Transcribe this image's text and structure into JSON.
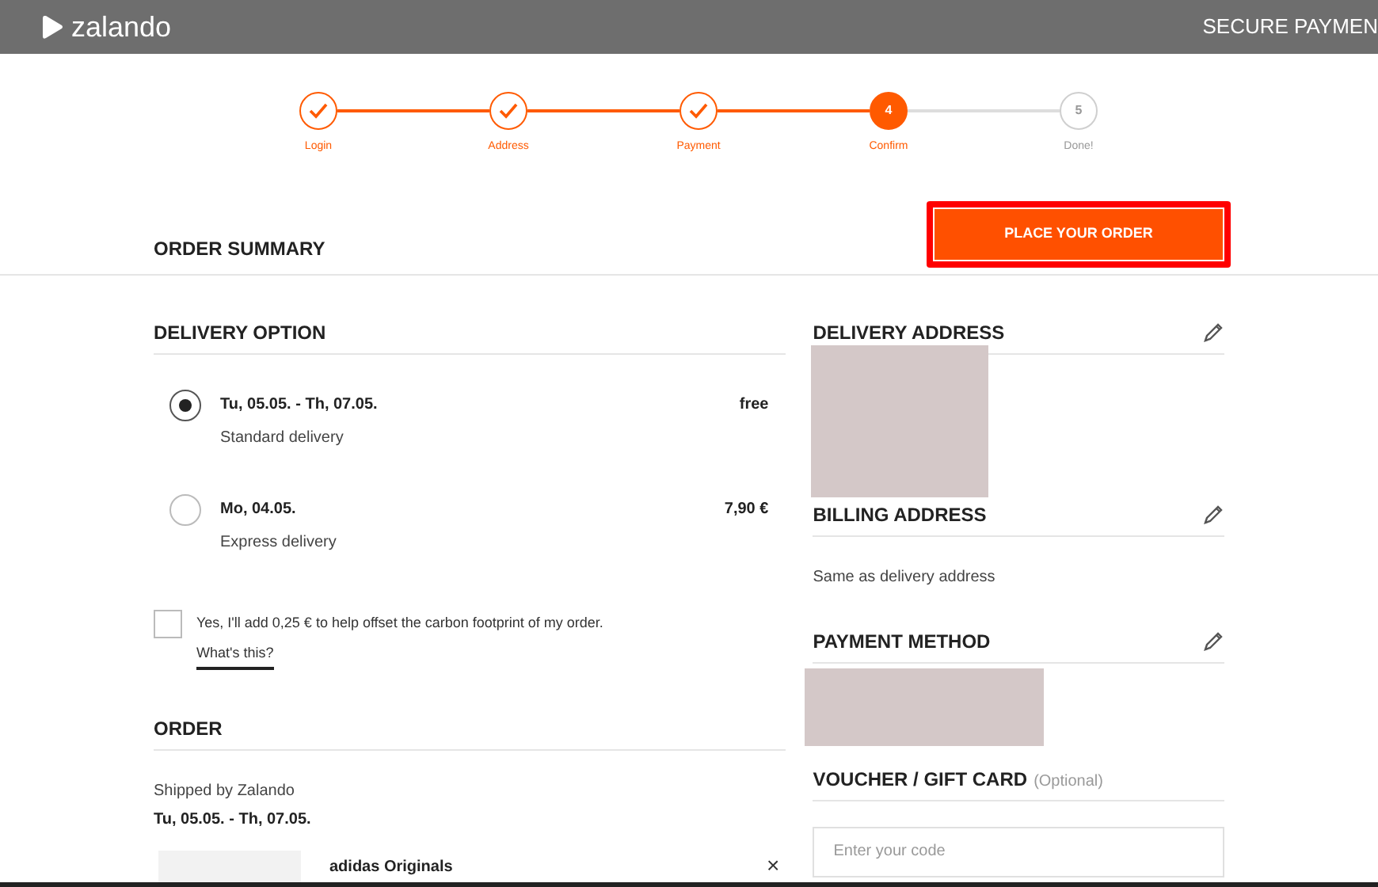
{
  "header": {
    "logo": "zalando",
    "title": "SECURE PAYMEN"
  },
  "steps": [
    {
      "label": "Login",
      "kind": "done"
    },
    {
      "label": "Address",
      "kind": "done"
    },
    {
      "label": "Payment",
      "kind": "done"
    },
    {
      "label": "Confirm",
      "kind": "current",
      "number": "4"
    },
    {
      "label": "Done!",
      "kind": "upcoming",
      "number": "5"
    }
  ],
  "summary": {
    "title": "ORDER SUMMARY",
    "button": {
      "label": "PLACE YOUR ORDER",
      "highlighted": true
    }
  },
  "delivery_option": {
    "title": "DELIVERY OPTION",
    "options": [
      {
        "date": "Tu, 05.05. - Th, 07.05.",
        "type": "Standard delivery",
        "price": "free",
        "selected": true
      },
      {
        "date": "Mo, 04.05.",
        "type": "Express delivery",
        "price": "7,90 €",
        "selected": false
      }
    ],
    "carbon_offset": {
      "label": "Yes, I'll add 0,25 € to help offset the carbon footprint of my order.",
      "checked": false,
      "link": "What's this?"
    }
  },
  "order": {
    "title": "ORDER",
    "shipped_by": "Shipped by Zalando",
    "date": "Tu, 05.05. - Th, 07.05.",
    "item": {
      "brand": "adidas Originals",
      "remove": "×"
    }
  },
  "delivery_address": {
    "title": "DELIVERY ADDRESS"
  },
  "billing_address": {
    "title": "BILLING ADDRESS",
    "text": "Same as delivery address"
  },
  "payment_method": {
    "title": "PAYMENT METHOD"
  },
  "voucher": {
    "title": "VOUCHER / GIFT CARD",
    "hint": "(Optional)",
    "placeholder": "Enter your code"
  }
}
